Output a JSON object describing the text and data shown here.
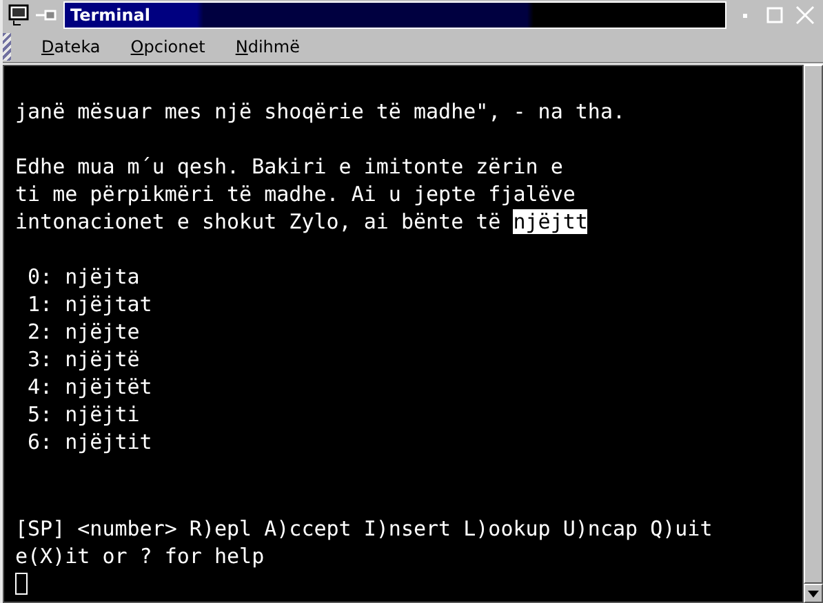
{
  "window": {
    "title": "Terminal"
  },
  "menu": [
    {
      "label": "Dateka"
    },
    {
      "label": "Opcionet"
    },
    {
      "label": "Ndihmë"
    }
  ],
  "terminal": {
    "paragraphs": [
      [
        {
          "text": "janë mësuar mes një shoqërie të madhe\", - na tha."
        }
      ],
      [
        {
          "text": "Edhe mua m´u qesh. Bakiri e imitonte zërin e"
        },
        {
          "text": "ti me përpikmëri të madhe. Ai u jepte fjalëve"
        },
        {
          "text": "intonacionet e shokut Zylo, ai bënte të ",
          "highlight": "njëjtt"
        }
      ]
    ],
    "candidates": [
      "0: njëjta",
      "1: njëjtat",
      "2: njëjte",
      "3: njëjtë",
      "4: njëjtët",
      "5: njëjti",
      "6: njëjtit"
    ],
    "prompt": [
      "[SP] <number> R)epl A)ccept I)nsert L)ookup U)ncap Q)uit",
      "e(X)it or ? for help"
    ],
    "cursor": true
  }
}
